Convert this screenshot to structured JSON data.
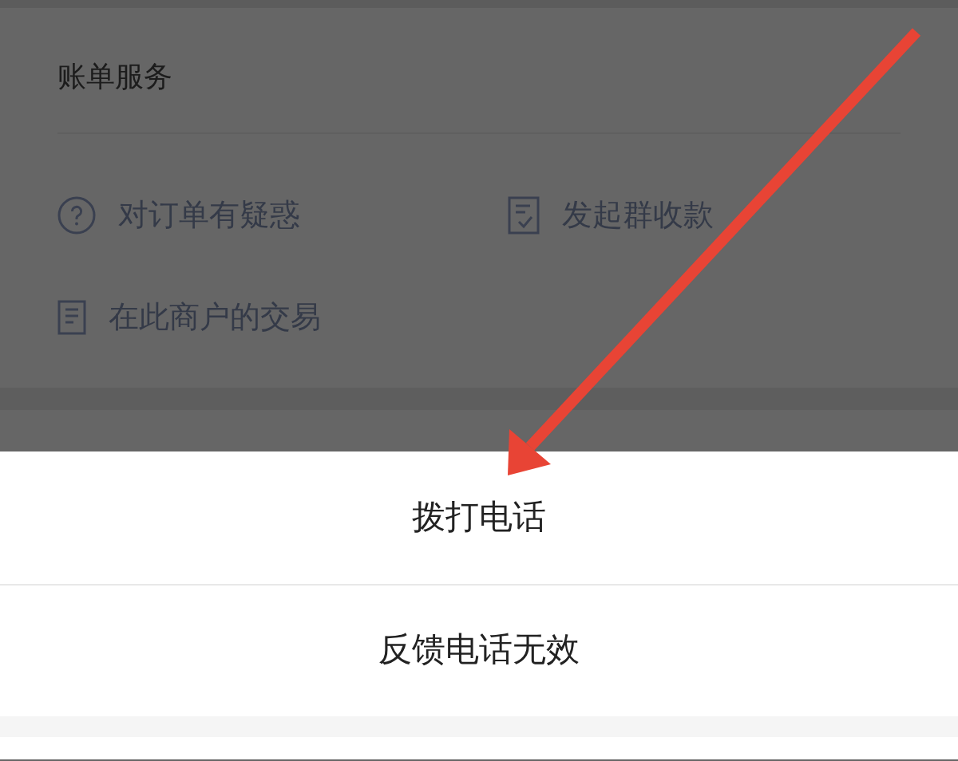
{
  "bill_services": {
    "title": "账单服务",
    "items": [
      {
        "label": "对订单有疑惑",
        "kind": "question"
      },
      {
        "label": "发起群收款",
        "kind": "check-document"
      },
      {
        "label": "在此商户的交易",
        "kind": "document"
      }
    ]
  },
  "action_sheet": {
    "options": [
      "拨打电话",
      "反馈电话无效"
    ]
  }
}
